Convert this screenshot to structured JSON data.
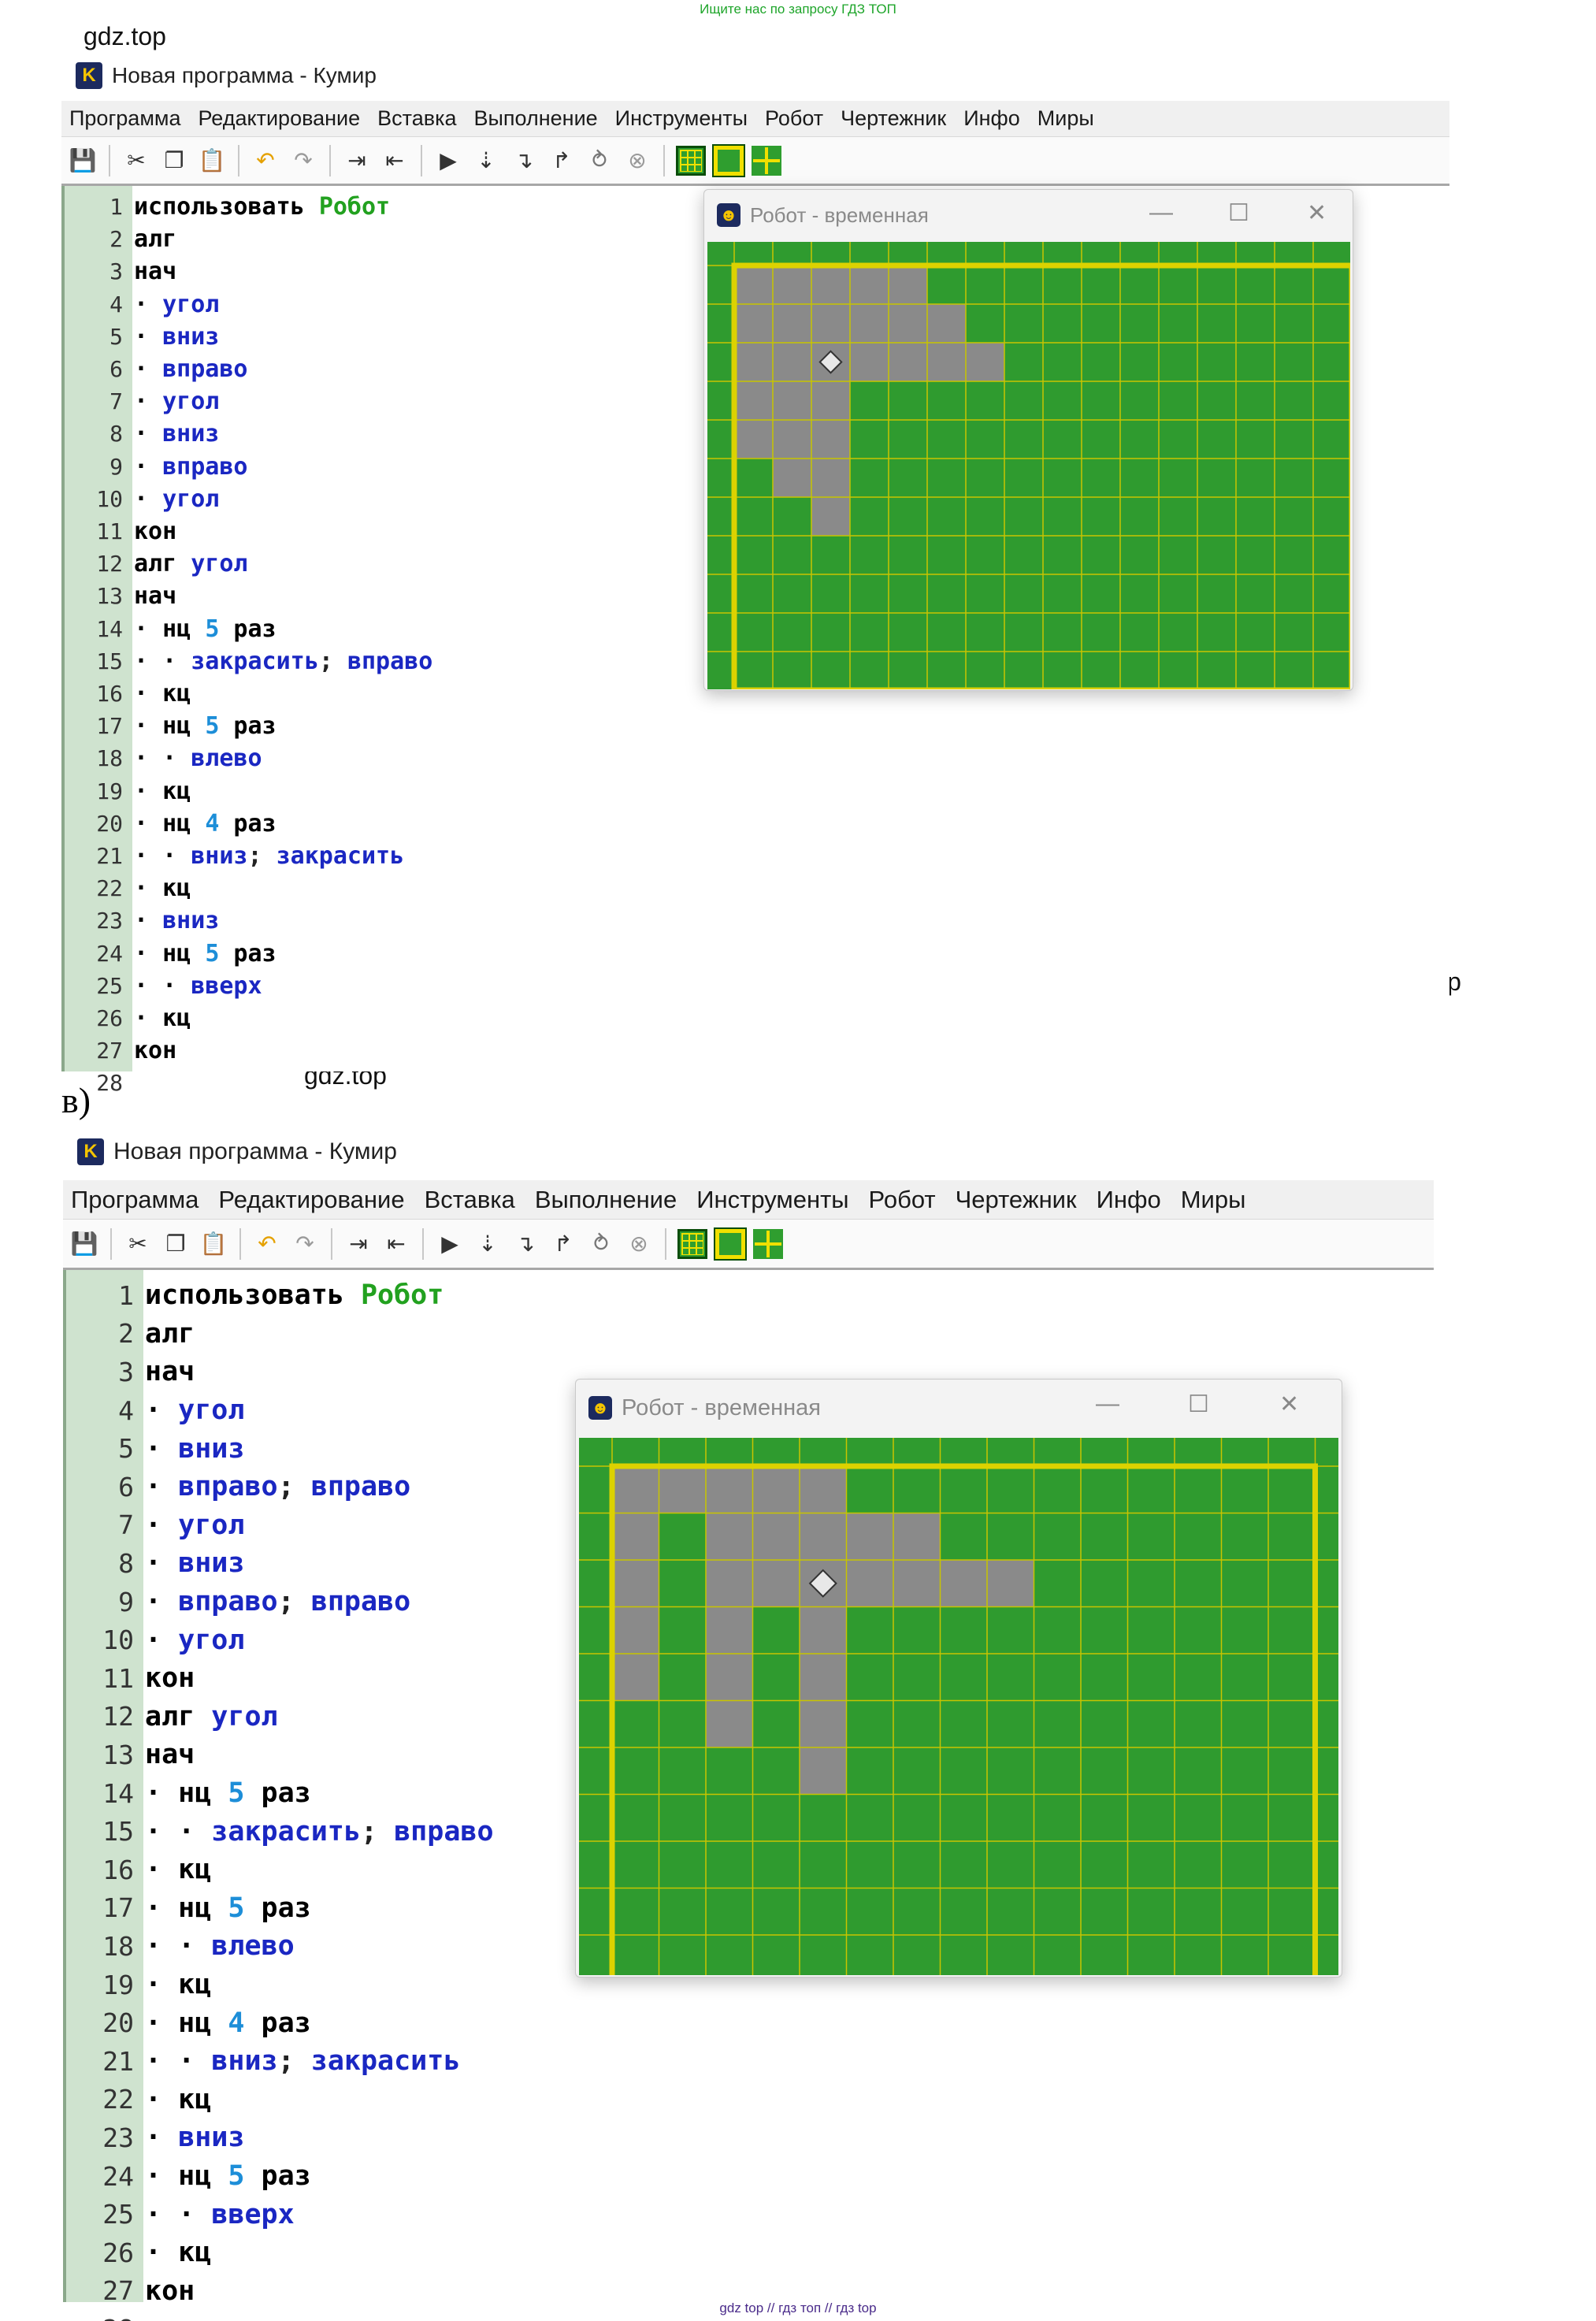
{
  "banners": {
    "top": "Ищите нас по запросу ГДЗ ТОП",
    "bottom": "gdz top  //  гдз топ  //  гдз top"
  },
  "part_label": "в)",
  "watermark": "gdz.top",
  "window": {
    "logo": "K",
    "title": "Новая программа - Кумир",
    "menu": [
      "Программа",
      "Редактирование",
      "Вставка",
      "Выполнение",
      "Инструменты",
      "Робот",
      "Чертежник",
      "Инфо",
      "Миры"
    ],
    "toolbar_icons": [
      "save-icon",
      "cut-icon",
      "copy-icon",
      "paste-icon",
      "undo-icon",
      "redo-icon",
      "indent-icon",
      "unindent-icon",
      "run-icon",
      "step-icon",
      "step-in-icon",
      "step-out-icon",
      "debug-icon",
      "stop-icon",
      "robot-grid-icon",
      "robot-frame-icon",
      "robot-cross-icon"
    ]
  },
  "robot_window": {
    "title": "Робот - временная",
    "minimize": "—",
    "maximize": "☐",
    "close": "✕"
  },
  "program_a": [
    [
      [
        "kw",
        "использовать "
      ],
      [
        "mod",
        "Робот"
      ]
    ],
    [
      [
        "kw",
        "алг"
      ]
    ],
    [
      [
        "kw",
        "нач"
      ]
    ],
    [
      [
        "kw",
        "· "
      ],
      [
        "fn",
        "угол"
      ]
    ],
    [
      [
        "kw",
        "· "
      ],
      [
        "fn",
        "вниз"
      ]
    ],
    [
      [
        "kw",
        "· "
      ],
      [
        "fn",
        "вправо"
      ]
    ],
    [
      [
        "kw",
        "· "
      ],
      [
        "fn",
        "угол"
      ]
    ],
    [
      [
        "kw",
        "· "
      ],
      [
        "fn",
        "вниз"
      ]
    ],
    [
      [
        "kw",
        "· "
      ],
      [
        "fn",
        "вправо"
      ]
    ],
    [
      [
        "kw",
        "· "
      ],
      [
        "fn",
        "угол"
      ]
    ],
    [
      [
        "kw",
        "кон"
      ]
    ],
    [
      [
        "kw",
        "алг "
      ],
      [
        "fn",
        "угол"
      ]
    ],
    [
      [
        "kw",
        "нач"
      ]
    ],
    [
      [
        "kw",
        "· нц "
      ],
      [
        "num",
        "5"
      ],
      [
        "kw",
        " раз"
      ]
    ],
    [
      [
        "kw",
        "· · "
      ],
      [
        "fn",
        "закрасить"
      ],
      [
        "punct",
        "; "
      ],
      [
        "fn",
        "вправо"
      ]
    ],
    [
      [
        "kw",
        "· кц"
      ]
    ],
    [
      [
        "kw",
        "· нц "
      ],
      [
        "num",
        "5"
      ],
      [
        "kw",
        " раз"
      ]
    ],
    [
      [
        "kw",
        "· · "
      ],
      [
        "fn",
        "влево"
      ]
    ],
    [
      [
        "kw",
        "· кц"
      ]
    ],
    [
      [
        "kw",
        "· нц "
      ],
      [
        "num",
        "4"
      ],
      [
        "kw",
        " раз"
      ]
    ],
    [
      [
        "kw",
        "· · "
      ],
      [
        "fn",
        "вниз"
      ],
      [
        "punct",
        "; "
      ],
      [
        "fn",
        "закрасить"
      ]
    ],
    [
      [
        "kw",
        "· кц"
      ]
    ],
    [
      [
        "kw",
        "· "
      ],
      [
        "fn",
        "вниз"
      ]
    ],
    [
      [
        "kw",
        "· нц "
      ],
      [
        "num",
        "5"
      ],
      [
        "kw",
        " раз"
      ]
    ],
    [
      [
        "kw",
        "· · "
      ],
      [
        "fn",
        "вверх"
      ]
    ],
    [
      [
        "kw",
        "· кц"
      ]
    ],
    [
      [
        "kw",
        "кон"
      ]
    ],
    []
  ],
  "program_b": [
    [
      [
        "kw",
        "использовать "
      ],
      [
        "mod",
        "Робот"
      ]
    ],
    [
      [
        "kw",
        "алг"
      ]
    ],
    [
      [
        "kw",
        "нач"
      ]
    ],
    [
      [
        "kw",
        "· "
      ],
      [
        "fn",
        "угол"
      ]
    ],
    [
      [
        "kw",
        "· "
      ],
      [
        "fn",
        "вниз"
      ]
    ],
    [
      [
        "kw",
        "· "
      ],
      [
        "fn",
        "вправо"
      ],
      [
        "punct",
        "; "
      ],
      [
        "fn",
        "вправо"
      ]
    ],
    [
      [
        "kw",
        "· "
      ],
      [
        "fn",
        "угол"
      ]
    ],
    [
      [
        "kw",
        "· "
      ],
      [
        "fn",
        "вниз"
      ]
    ],
    [
      [
        "kw",
        "· "
      ],
      [
        "fn",
        "вправо"
      ],
      [
        "punct",
        "; "
      ],
      [
        "fn",
        "вправо"
      ]
    ],
    [
      [
        "kw",
        "· "
      ],
      [
        "fn",
        "угол"
      ]
    ],
    [
      [
        "kw",
        "кон"
      ]
    ],
    [
      [
        "kw",
        "алг "
      ],
      [
        "fn",
        "угол"
      ]
    ],
    [
      [
        "kw",
        "нач"
      ]
    ],
    [
      [
        "kw",
        "· нц "
      ],
      [
        "num",
        "5"
      ],
      [
        "kw",
        " раз"
      ]
    ],
    [
      [
        "kw",
        "· · "
      ],
      [
        "fn",
        "закрасить"
      ],
      [
        "punct",
        "; "
      ],
      [
        "fn",
        "вправо"
      ]
    ],
    [
      [
        "kw",
        "· кц"
      ]
    ],
    [
      [
        "kw",
        "· нц "
      ],
      [
        "num",
        "5"
      ],
      [
        "kw",
        " раз"
      ]
    ],
    [
      [
        "kw",
        "· · "
      ],
      [
        "fn",
        "влево"
      ]
    ],
    [
      [
        "kw",
        "· кц"
      ]
    ],
    [
      [
        "kw",
        "· нц "
      ],
      [
        "num",
        "4"
      ],
      [
        "kw",
        " раз"
      ]
    ],
    [
      [
        "kw",
        "· · "
      ],
      [
        "fn",
        "вниз"
      ],
      [
        "punct",
        "; "
      ],
      [
        "fn",
        "закрасить"
      ]
    ],
    [
      [
        "kw",
        "· кц"
      ]
    ],
    [
      [
        "kw",
        "· "
      ],
      [
        "fn",
        "вниз"
      ]
    ],
    [
      [
        "kw",
        "· нц "
      ],
      [
        "num",
        "5"
      ],
      [
        "kw",
        " раз"
      ]
    ],
    [
      [
        "kw",
        "· · "
      ],
      [
        "fn",
        "вверх"
      ]
    ],
    [
      [
        "kw",
        "· кц"
      ]
    ],
    [
      [
        "kw",
        "кон"
      ]
    ],
    []
  ],
  "field_a": {
    "cols": 16,
    "rows": 11,
    "painted": [
      [
        0,
        0
      ],
      [
        1,
        0
      ],
      [
        2,
        0
      ],
      [
        3,
        0
      ],
      [
        4,
        0
      ],
      [
        0,
        1
      ],
      [
        1,
        1
      ],
      [
        2,
        1
      ],
      [
        3,
        1
      ],
      [
        4,
        1
      ],
      [
        5,
        1
      ],
      [
        0,
        2
      ],
      [
        1,
        2
      ],
      [
        2,
        2
      ],
      [
        3,
        2
      ],
      [
        4,
        2
      ],
      [
        5,
        2
      ],
      [
        6,
        2
      ],
      [
        0,
        3
      ],
      [
        1,
        3
      ],
      [
        2,
        3
      ],
      [
        0,
        4
      ],
      [
        1,
        4
      ],
      [
        2,
        4
      ],
      [
        1,
        5
      ],
      [
        2,
        5
      ],
      [
        2,
        6
      ]
    ],
    "robot": [
      2,
      2
    ],
    "colors": {
      "grass": "#2f9b2f",
      "painted": "#8a8a8a",
      "grid": "#c8c400",
      "wall": "#dcd200"
    }
  },
  "field_b": {
    "cols": 15,
    "rows": 11,
    "painted": [
      [
        0,
        0
      ],
      [
        1,
        0
      ],
      [
        2,
        0
      ],
      [
        3,
        0
      ],
      [
        4,
        0
      ],
      [
        0,
        1
      ],
      [
        2,
        1
      ],
      [
        3,
        1
      ],
      [
        4,
        1
      ],
      [
        5,
        1
      ],
      [
        6,
        1
      ],
      [
        0,
        2
      ],
      [
        2,
        2
      ],
      [
        3,
        2
      ],
      [
        4,
        2
      ],
      [
        5,
        2
      ],
      [
        6,
        2
      ],
      [
        7,
        2
      ],
      [
        8,
        2
      ],
      [
        0,
        3
      ],
      [
        2,
        3
      ],
      [
        4,
        3
      ],
      [
        0,
        4
      ],
      [
        2,
        4
      ],
      [
        4,
        4
      ],
      [
        2,
        5
      ],
      [
        4,
        5
      ],
      [
        4,
        6
      ]
    ],
    "robot": [
      4,
      2
    ],
    "colors": {
      "grass": "#2f9b2f",
      "painted": "#8a8a8a",
      "grid": "#c8c400",
      "wall": "#dcd200"
    }
  }
}
